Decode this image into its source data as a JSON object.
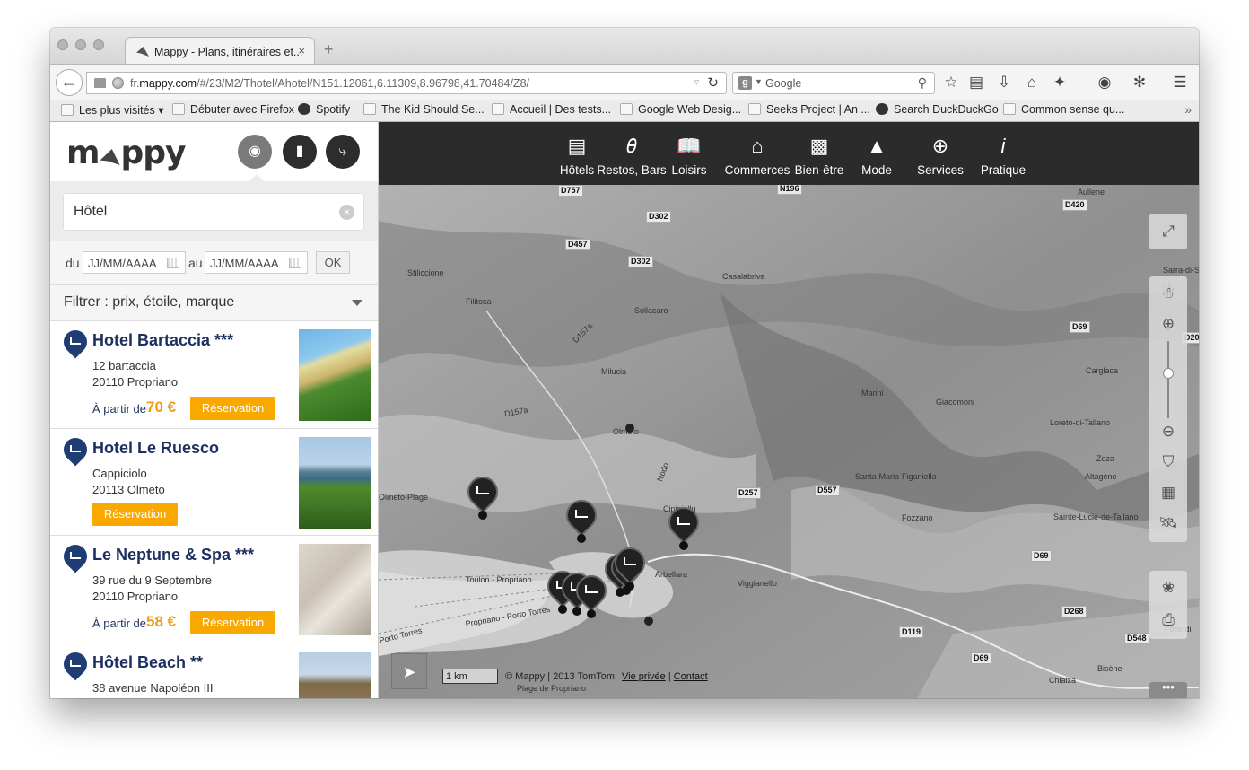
{
  "browser": {
    "tab_title": "Mappy - Plans, itinéraires et...",
    "tab_close": "×",
    "new_tab": "+",
    "url_prefix": "fr.",
    "url_domain": "mappy.com",
    "url_path": "/#/23/M2/Thotel/Ahotel/N151.12061,6.11309,8.96798,41.70484/Z8/",
    "search_placeholder": "Google",
    "bookmarks": [
      "Les plus visités",
      "Débuter avec Firefox",
      "Spotify",
      "The Kid Should Se...",
      "Accueil | Des tests...",
      "Google Web Desig...",
      "Seeks Project | An ...",
      "Search DuckDuckGo",
      "Common sense qu..."
    ],
    "bookmarks_more": "»"
  },
  "sidebar": {
    "logo": "mappy",
    "search_value": "Hôtel",
    "clear_icon": "×",
    "date_from_label": "du",
    "date_to_label": "au",
    "date_from_placeholder": "JJ/MM/AAAA",
    "date_to_placeholder": "JJ/MM/AAAA",
    "ok_label": "OK",
    "filter_label": "Filtrer : prix, étoile, marque",
    "results": [
      {
        "name": "Hotel Bartaccia ***",
        "addr1": "12 bartaccia",
        "addr2": "20110 Propriano",
        "price_label": "À partir de",
        "price": "70 €",
        "button": "Réservation"
      },
      {
        "name": "Hotel Le Ruesco",
        "addr1": "Cappiciolo",
        "addr2": "20113 Olmeto",
        "price_label": "",
        "price": "",
        "button": "Réservation"
      },
      {
        "name": "Le Neptune & Spa ***",
        "addr1": "39 rue du 9 Septembre",
        "addr2": "20110 Propriano",
        "price_label": "À partir de",
        "price": "58 €",
        "button": "Réservation"
      },
      {
        "name": "Hôtel Beach **",
        "addr1": "38 avenue Napoléon III",
        "addr2": "",
        "price_label": "",
        "price": "",
        "button": ""
      }
    ]
  },
  "map": {
    "categories": [
      {
        "label": "Hôtels",
        "icon": "bed-icon"
      },
      {
        "label": "Restos, Bars",
        "icon": "cutlery-icon"
      },
      {
        "label": "Loisirs",
        "icon": "book-icon"
      },
      {
        "label": "Commerces",
        "icon": "shop-icon"
      },
      {
        "label": "Bien-être",
        "icon": "perfume-icon"
      },
      {
        "label": "Mode",
        "icon": "dress-icon"
      },
      {
        "label": "Services",
        "icon": "car-plus-icon"
      },
      {
        "label": "Pratique",
        "icon": "info-icon"
      }
    ],
    "roads": [
      "D757",
      "D302",
      "D457",
      "D302",
      "D420",
      "D69",
      "D20",
      "D257",
      "D557",
      "D69",
      "D268",
      "D119",
      "D548",
      "D69",
      "N196"
    ],
    "places": [
      "Sollacaro",
      "Casalabriva",
      "Filitosa",
      "Stiliccione",
      "Milucia",
      "Giacomoni",
      "Carglaca",
      "Loreto-di-Tallano",
      "Zoza",
      "Altagène",
      "Santa-Maria-Figaniella",
      "Fozzano",
      "Sainte-Lucie-de-Tallano",
      "Olmeto-Plage",
      "Cipiniellu",
      "Viggianello",
      "Arbellara",
      "Toulon - Propriano",
      "Propriano - Porto Torres",
      "Bisène",
      "Chialza",
      "Aullene",
      "Sarra-di-S",
      "Foce di",
      "Plage de Propriano",
      "Olmeto",
      "Porto Torres",
      "D157a",
      "D157a",
      "Nodo",
      "Marini"
    ],
    "scale_label": "1 km",
    "copyright": "© Mappy | 2013 TomTom",
    "privacy_link": "Vie privée",
    "contact_link": "Contact",
    "more_label": "•••"
  }
}
